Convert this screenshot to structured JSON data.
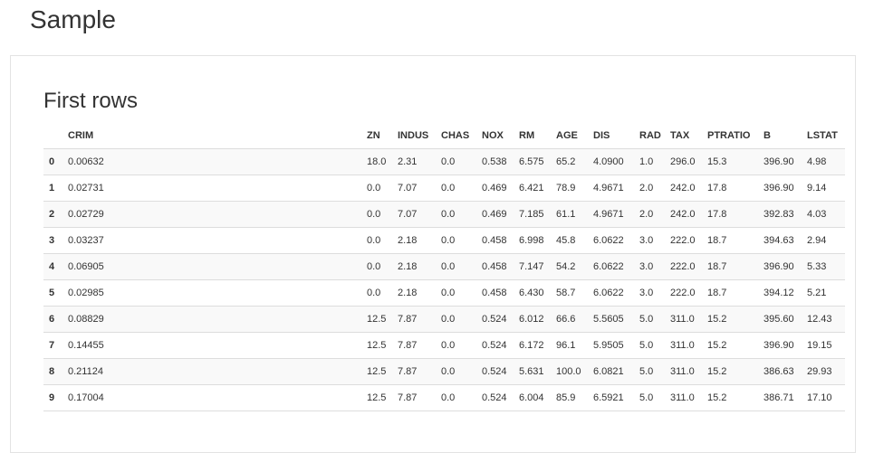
{
  "page": {
    "title": "Sample"
  },
  "panel": {
    "title": "First rows"
  },
  "table": {
    "columns": [
      "",
      "CRIM",
      "ZN",
      "INDUS",
      "CHAS",
      "NOX",
      "RM",
      "AGE",
      "DIS",
      "RAD",
      "TAX",
      "PTRATIO",
      "B",
      "LSTAT"
    ],
    "rows": [
      [
        "0",
        "0.00632",
        "18.0",
        "2.31",
        "0.0",
        "0.538",
        "6.575",
        "65.2",
        "4.0900",
        "1.0",
        "296.0",
        "15.3",
        "396.90",
        "4.98"
      ],
      [
        "1",
        "0.02731",
        "0.0",
        "7.07",
        "0.0",
        "0.469",
        "6.421",
        "78.9",
        "4.9671",
        "2.0",
        "242.0",
        "17.8",
        "396.90",
        "9.14"
      ],
      [
        "2",
        "0.02729",
        "0.0",
        "7.07",
        "0.0",
        "0.469",
        "7.185",
        "61.1",
        "4.9671",
        "2.0",
        "242.0",
        "17.8",
        "392.83",
        "4.03"
      ],
      [
        "3",
        "0.03237",
        "0.0",
        "2.18",
        "0.0",
        "0.458",
        "6.998",
        "45.8",
        "6.0622",
        "3.0",
        "222.0",
        "18.7",
        "394.63",
        "2.94"
      ],
      [
        "4",
        "0.06905",
        "0.0",
        "2.18",
        "0.0",
        "0.458",
        "7.147",
        "54.2",
        "6.0622",
        "3.0",
        "222.0",
        "18.7",
        "396.90",
        "5.33"
      ],
      [
        "5",
        "0.02985",
        "0.0",
        "2.18",
        "0.0",
        "0.458",
        "6.430",
        "58.7",
        "6.0622",
        "3.0",
        "222.0",
        "18.7",
        "394.12",
        "5.21"
      ],
      [
        "6",
        "0.08829",
        "12.5",
        "7.87",
        "0.0",
        "0.524",
        "6.012",
        "66.6",
        "5.5605",
        "5.0",
        "311.0",
        "15.2",
        "395.60",
        "12.43"
      ],
      [
        "7",
        "0.14455",
        "12.5",
        "7.87",
        "0.0",
        "0.524",
        "6.172",
        "96.1",
        "5.9505",
        "5.0",
        "311.0",
        "15.2",
        "396.90",
        "19.15"
      ],
      [
        "8",
        "0.21124",
        "12.5",
        "7.87",
        "0.0",
        "0.524",
        "5.631",
        "100.0",
        "6.0821",
        "5.0",
        "311.0",
        "15.2",
        "386.63",
        "29.93"
      ],
      [
        "9",
        "0.17004",
        "12.5",
        "7.87",
        "0.0",
        "0.524",
        "6.004",
        "85.9",
        "6.5921",
        "5.0",
        "311.0",
        "15.2",
        "386.71",
        "17.10"
      ]
    ]
  }
}
